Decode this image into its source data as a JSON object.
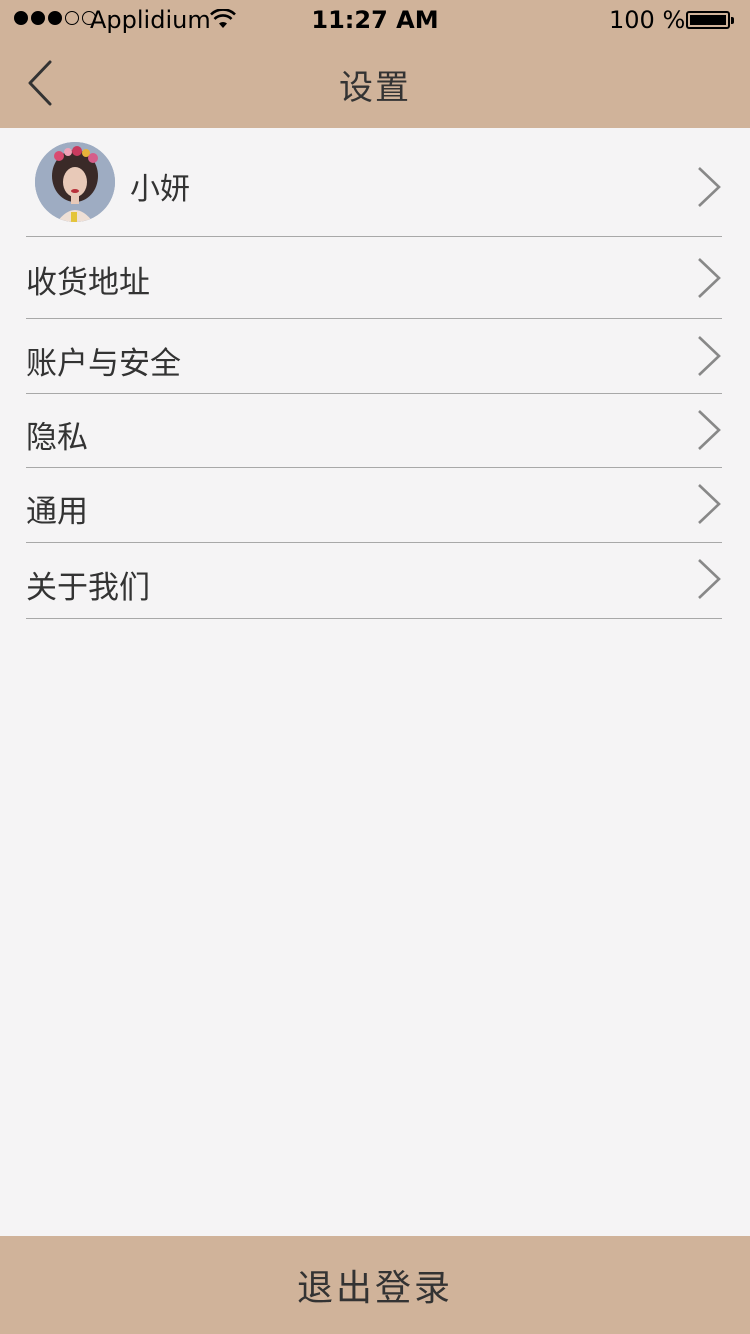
{
  "status_bar": {
    "carrier": "Applidium",
    "time": "11:27 AM",
    "battery": "100 %",
    "signal_strength": 3,
    "signal_max": 5
  },
  "nav": {
    "title": "设置",
    "back_icon": "chevron-left-icon"
  },
  "profile": {
    "name": "小妍",
    "avatar_icon": "avatar-photo"
  },
  "menu": {
    "items": [
      {
        "label": "收货地址"
      },
      {
        "label": "账户与安全"
      },
      {
        "label": "隐私"
      },
      {
        "label": "通用"
      },
      {
        "label": "关于我们"
      }
    ]
  },
  "footer": {
    "logout_label": "退出登录"
  },
  "colors": {
    "header_bg": "#d0b39a",
    "page_bg": "#f5f4f5",
    "separator": "#a8a8a8",
    "chevron": "#888888"
  }
}
